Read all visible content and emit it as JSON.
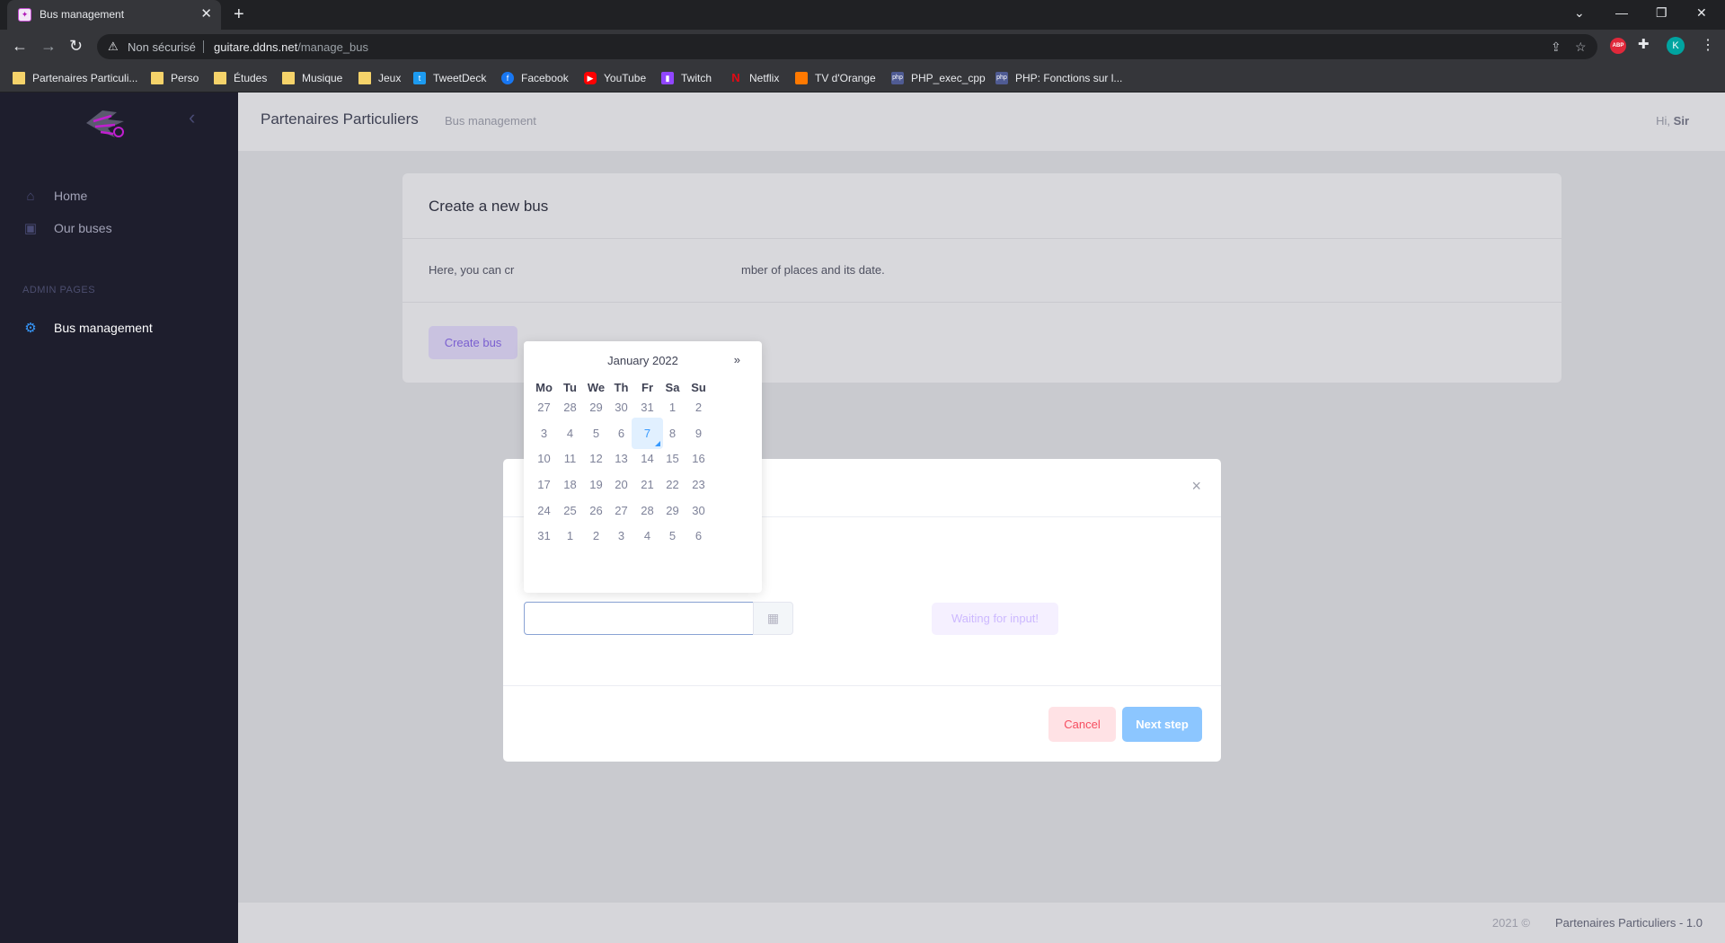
{
  "browser": {
    "tab_title": "Bus management",
    "tab_close": "✕",
    "new_tab": "+",
    "security_label": "Non sécurisé",
    "url_host": "guitare.ddns.net",
    "url_path": "/manage_bus",
    "profile_initial": "K",
    "abp_label": "ABP",
    "bookmarks": [
      {
        "label": "Partenaires Particuli...",
        "icon": "folder-icon"
      },
      {
        "label": "Perso",
        "icon": "folder-icon"
      },
      {
        "label": "Études",
        "icon": "folder-icon"
      },
      {
        "label": "Musique",
        "icon": "folder-icon"
      },
      {
        "label": "Jeux",
        "icon": "folder-icon"
      },
      {
        "label": "TweetDeck",
        "icon": "tweetdeck-icon"
      },
      {
        "label": "Facebook",
        "icon": "facebook-icon"
      },
      {
        "label": "YouTube",
        "icon": "youtube-icon"
      },
      {
        "label": "Twitch",
        "icon": "twitch-icon"
      },
      {
        "label": "Netflix",
        "icon": "netflix-icon"
      },
      {
        "label": "TV d'Orange",
        "icon": "orange-icon"
      },
      {
        "label": "PHP_exec_cpp",
        "icon": "php-icon"
      },
      {
        "label": "PHP: Fonctions sur l...",
        "icon": "php-icon"
      }
    ]
  },
  "sidebar": {
    "items": [
      {
        "label": "Home",
        "icon": "home-icon"
      },
      {
        "label": "Our buses",
        "icon": "bus-icon"
      }
    ],
    "section_label": "ADMIN PAGES",
    "admin_items": [
      {
        "label": "Bus management",
        "icon": "gear-icon"
      }
    ]
  },
  "header": {
    "title": "Partenaires Particuliers",
    "subtitle": "Bus management",
    "greeting": "Hi,",
    "user": "Sir"
  },
  "card": {
    "title": "Create a new bus",
    "text_left": "Here, you can cr",
    "text_right": "mber of places and its date.",
    "create_button": "Create bus"
  },
  "modal": {
    "close": "×",
    "date_value": "",
    "status": "Waiting for input!",
    "cancel_button": "Cancel",
    "next_button": "Next step"
  },
  "datepicker": {
    "title": "January 2022",
    "next": "»",
    "weekdays": [
      "Mo",
      "Tu",
      "We",
      "Th",
      "Fr",
      "Sa",
      "Su"
    ],
    "weeks": [
      [
        "27",
        "28",
        "29",
        "30",
        "31",
        "1",
        "2"
      ],
      [
        "3",
        "4",
        "5",
        "6",
        "7",
        "8",
        "9"
      ],
      [
        "10",
        "11",
        "12",
        "13",
        "14",
        "15",
        "16"
      ],
      [
        "17",
        "18",
        "19",
        "20",
        "21",
        "22",
        "23"
      ],
      [
        "24",
        "25",
        "26",
        "27",
        "28",
        "29",
        "30"
      ],
      [
        "31",
        "1",
        "2",
        "3",
        "4",
        "5",
        "6"
      ]
    ],
    "today": "7"
  },
  "footer": {
    "year": "2021 ©",
    "name": "Partenaires Particuliers - 1.0"
  },
  "colors": {
    "sidebar_bg": "#1e1e2d",
    "primary": "#3699ff",
    "danger": "#f64e60",
    "accent_purple": "#8950fc"
  }
}
